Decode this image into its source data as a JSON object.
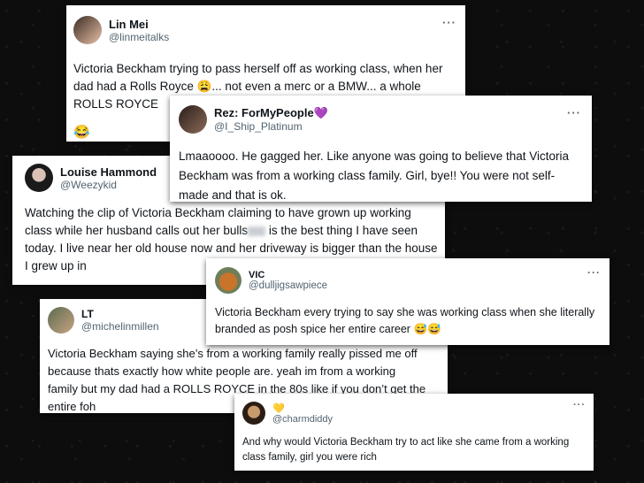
{
  "tweets": [
    {
      "name": "Lin Mei",
      "handle": "@linmeitalks",
      "more": "···",
      "text": "Victoria Beckham trying to pass herself off as working class, when her dad had a Rolls Royce 😩... not even a merc or a BMW... a whole ROLLS ROYCE",
      "footer_emoji": "😂"
    },
    {
      "name": "Rez: ForMyPeople",
      "name_emoji": "💜",
      "handle": "@I_Ship_Platinum",
      "more": "···",
      "text": "Lmaaoooo. He gagged her. Like anyone was going to believe that Victoria Beckham was from a working class  family. Girl, bye!! You were not self-made and that is ok."
    },
    {
      "name": "Louise Hammond",
      "handle": "@Weezykid",
      "text_before": "Watching the clip of Victoria Beckham claiming to have grown up working class while her husband calls out her bulls",
      "text_after": " is the best thing I have seen today. I live near her old house now and her driveway is bigger than the house I grew up in"
    },
    {
      "name": "VIC",
      "handle": "@dulljigsawpiece",
      "more": "···",
      "text": "Victoria Beckham every trying to say she was working class when she literally branded as posh spice her entire career 😅😅"
    },
    {
      "name": "LT",
      "handle": "@michelinmillen",
      "text": "Victoria Beckham saying she’s from a working family really pissed me off because thats exactly how white people are. yeah im from a working family but my dad had a ROLLS ROYCE in the 80s like if you don’t get the entire foh"
    },
    {
      "name": "💛",
      "handle": "@charmdiddy",
      "more": "···",
      "text": "And why would Victoria Beckham try to act like she came from a working class family, girl you were rich"
    }
  ]
}
